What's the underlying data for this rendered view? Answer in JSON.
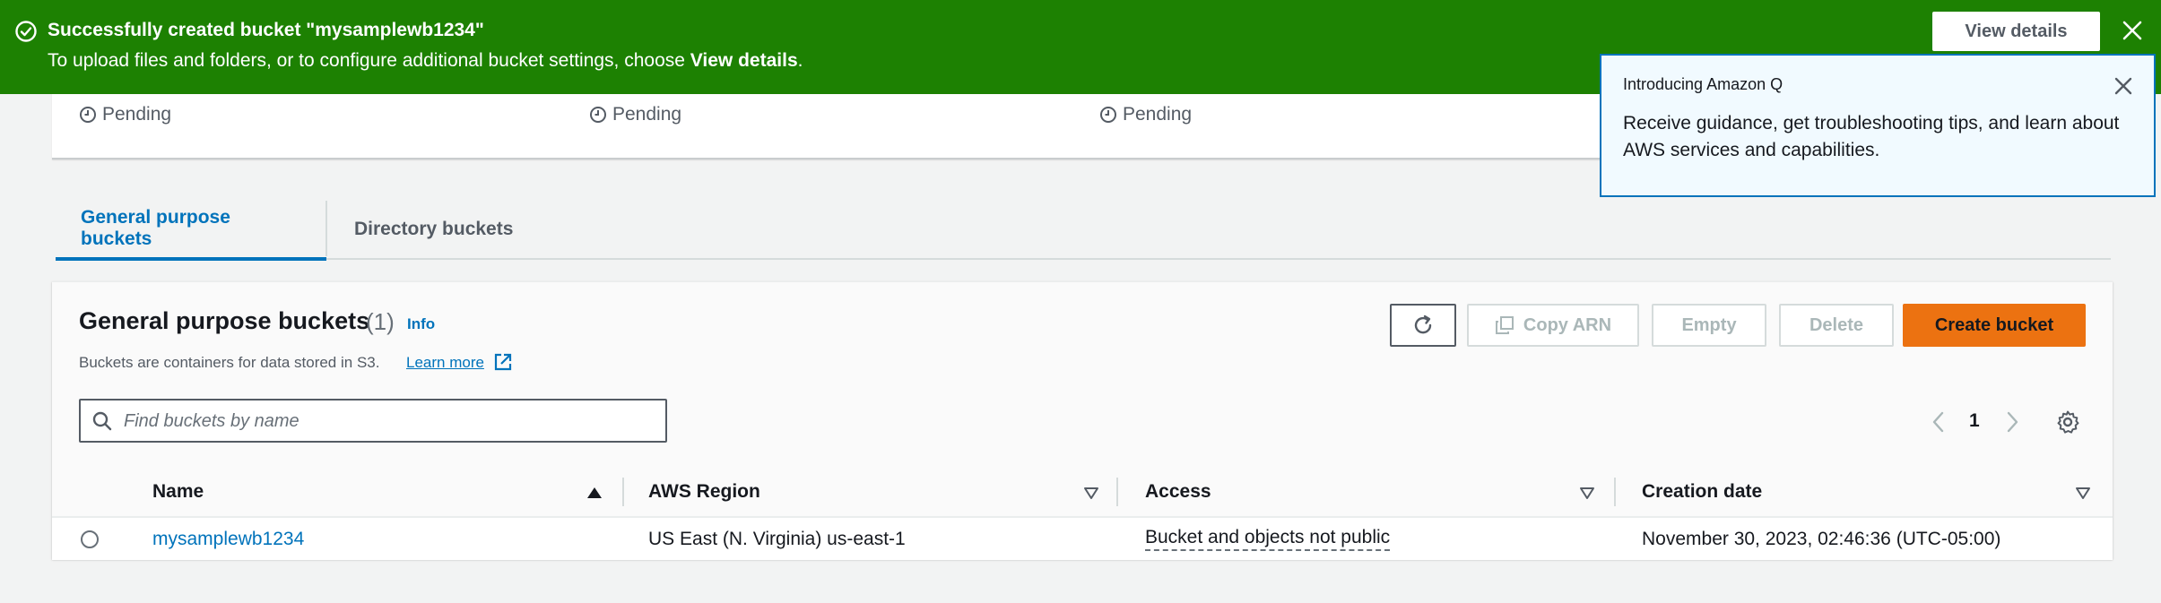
{
  "flash": {
    "title": "Successfully created bucket \"mysamplewb1234\"",
    "message_prefix": "To upload files and folders, or to configure additional bucket settings, choose ",
    "message_link": "View details",
    "message_suffix": ".",
    "view_details_button": "View details",
    "color": "#1d8102"
  },
  "status_card": {
    "items": [
      "Pending",
      "Pending",
      "Pending"
    ]
  },
  "amazon_q_popover": {
    "pre_title": "Introducing Amazon Q",
    "body": "Receive guidance, get troubleshooting tips, and learn about AWS services and capabilities."
  },
  "tabs": [
    {
      "label": "General purpose buckets",
      "active": true
    },
    {
      "label": "Directory buckets",
      "active": false
    }
  ],
  "panel": {
    "title": "General purpose buckets",
    "count": "(1)",
    "info_link": "Info",
    "description": "Buckets are containers for data stored in S3.",
    "learn_more": "Learn more",
    "buttons": {
      "copy_arn": "Copy ARN",
      "empty": "Empty",
      "delete": "Delete",
      "create": "Create bucket"
    },
    "search_placeholder": "Find buckets by name",
    "page_number": "1",
    "accent": "#ec7211"
  },
  "table": {
    "columns": [
      "Name",
      "AWS Region",
      "Access",
      "Creation date"
    ],
    "rows": [
      {
        "name": "mysamplewb1234",
        "region": "US East (N. Virginia) us-east-1",
        "access": "Bucket and objects not public",
        "created": "November 30, 2023, 02:46:36 (UTC-05:00)"
      }
    ]
  }
}
